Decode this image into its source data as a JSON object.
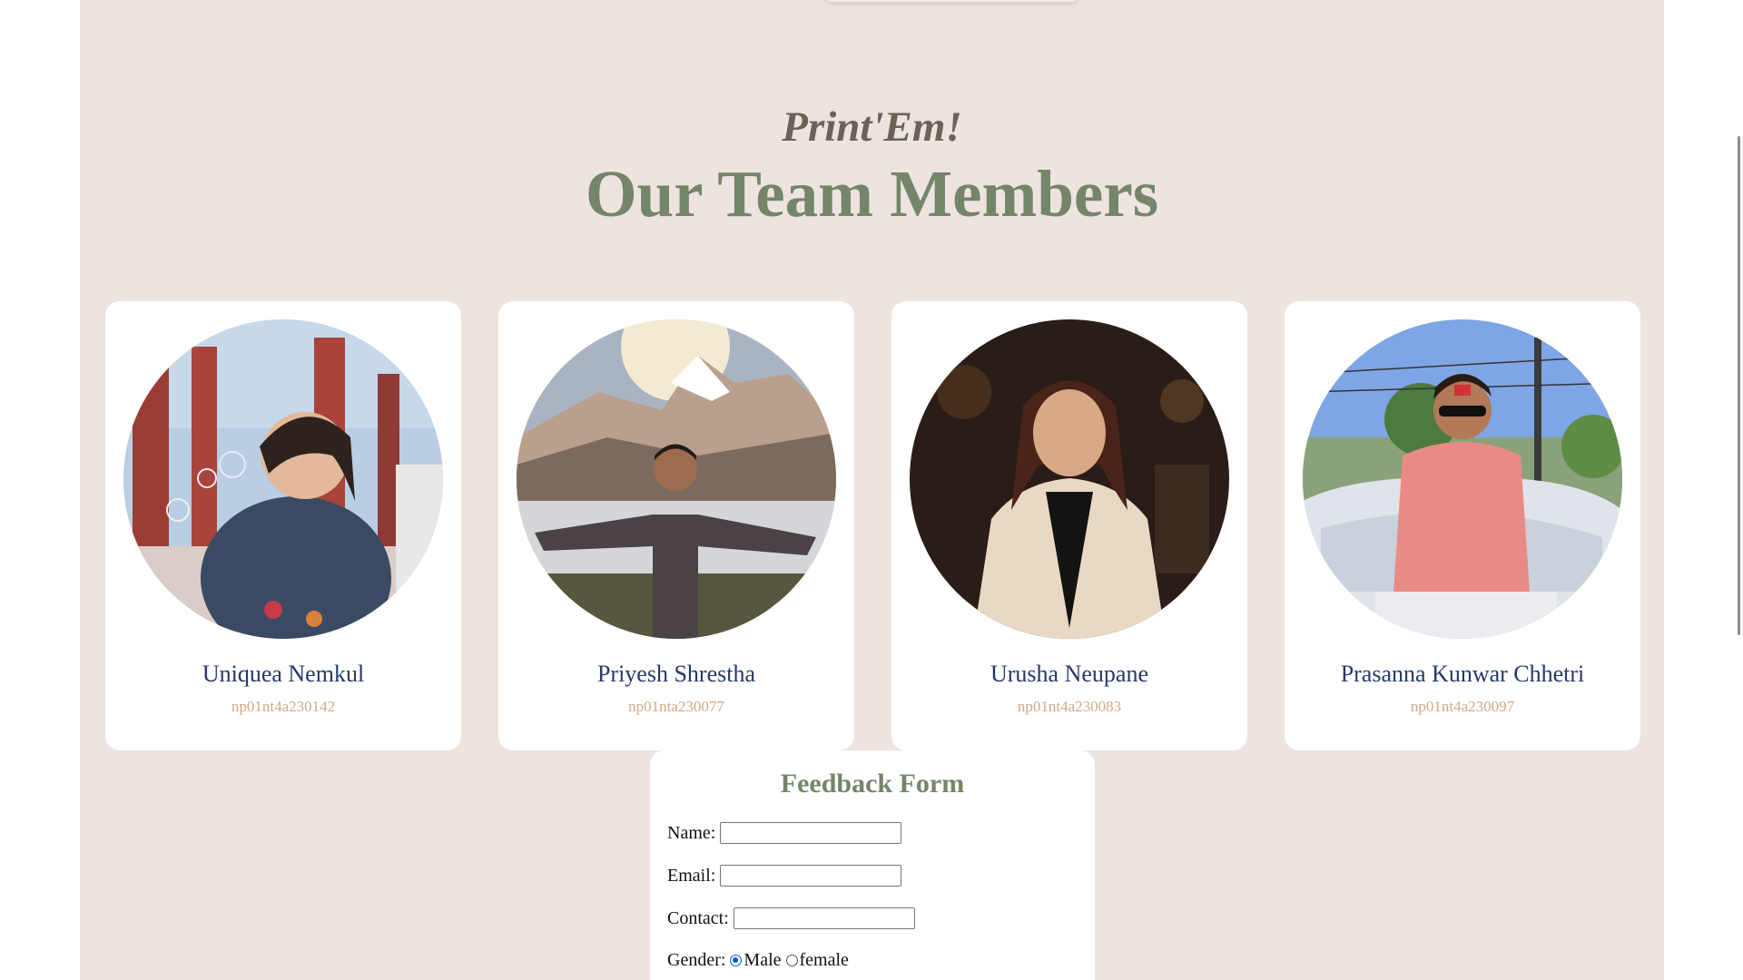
{
  "header": {
    "subtitle": "Print'Em!",
    "title": "Our Team Members"
  },
  "team": [
    {
      "name": "Uniquea Nemkul",
      "id": "np01nt4a230142",
      "photo": "woman-blowing-bubbles-photo"
    },
    {
      "name": "Priyesh Shrestha",
      "id": "np01nta230077",
      "photo": "man-mountain-view-photo"
    },
    {
      "name": "Urusha Neupane",
      "id": "np01nt4a230083",
      "photo": "woman-beige-coat-photo"
    },
    {
      "name": "Prasanna Kunwar Chhetri",
      "id": "np01nt4a230097",
      "photo": "man-on-car-photo"
    }
  ],
  "feedback_form": {
    "title": "Feedback Form",
    "name_label": "Name:",
    "name_value": "",
    "email_label": "Email:",
    "email_value": "",
    "contact_label": "Contact:",
    "contact_value": "",
    "gender_label": "Gender:",
    "gender_options": [
      "Male",
      "female"
    ],
    "gender_selected": "Male"
  },
  "colors": {
    "page_background": "#ede4e0",
    "title": "#74856a",
    "subtitle": "#6e6157",
    "member_name": "#27386b",
    "member_id": "#d2a887"
  }
}
